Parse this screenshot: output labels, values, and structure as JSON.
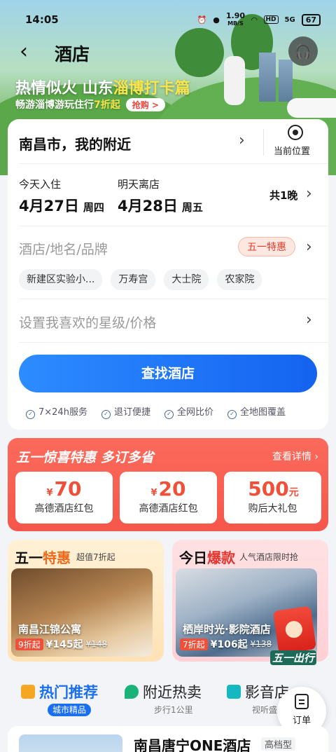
{
  "status_bar": {
    "time": "14:05",
    "speed_value": "1.90",
    "speed_unit": "MB/S",
    "hd": "HD",
    "network": "5G",
    "battery": "67"
  },
  "header": {
    "title": "酒店"
  },
  "banner": {
    "title_part1": "热情似火 山东",
    "title_highlight": "淄博打卡篇",
    "subtitle_part1": "畅游淄博游玩住行",
    "subtitle_highlight": "7折起",
    "grab_button": "抢购 >"
  },
  "search": {
    "city": "南昌市，我的附近",
    "location_button": "当前位置",
    "checkin_label": "今天入住",
    "checkin_date": "4月27日",
    "checkin_weekday": "周四",
    "checkout_label": "明天离店",
    "checkout_date": "4月28日",
    "checkout_weekday": "周五",
    "nights": "共1晚",
    "keyword_placeholder": "酒店/地名/品牌",
    "promo_badge": "五一特惠",
    "tags": [
      "新建区实验小...",
      "万寿宫",
      "大士院",
      "农家院"
    ],
    "star_price_placeholder": "设置我喜欢的星级/价格",
    "find_button": "查找酒店",
    "guarantees": [
      "7×24h服务",
      "退订便捷",
      "全网比价",
      "全地图覆盖"
    ]
  },
  "red_promo": {
    "title": "五一惊喜特惠 多订多省",
    "more": "查看详情",
    "coupons": [
      {
        "currency": "¥",
        "amount": "70",
        "unit": "",
        "name": "高德酒店红包"
      },
      {
        "currency": "¥",
        "amount": "20",
        "unit": "",
        "name": "高德酒店红包"
      },
      {
        "currency": "",
        "amount": "500",
        "unit": "元",
        "name": "购后大礼包"
      }
    ]
  },
  "deals": [
    {
      "title_part1": "五一",
      "title_accent": "特惠",
      "subtitle": "超值7折起",
      "hotel_name": "南昌江锦公寓",
      "discount": "9折起",
      "price": "¥145起",
      "original": "¥148"
    },
    {
      "title_part1": "今日",
      "title_accent": "爆款",
      "subtitle": "人气酒店限时抢",
      "hotel_name": "栖岸时光·影院酒店",
      "discount": "7折起",
      "price": "¥106起",
      "original": "¥138"
    }
  ],
  "hongbao_label": "五一出行",
  "tabs": [
    {
      "label": "热门推荐",
      "sub": "城市精品"
    },
    {
      "label": "附近热卖",
      "sub": "步行1公里"
    },
    {
      "label": "影音店",
      "sub": "视听盛"
    }
  ],
  "order_button": "订单",
  "hotel_item": {
    "name": "南昌唐宁ONE酒店",
    "level": "高档型"
  },
  "colors": {
    "primary": "#1a6ff0",
    "promo_red": "#f5574a",
    "deal_orange": "#ef6a1d"
  }
}
